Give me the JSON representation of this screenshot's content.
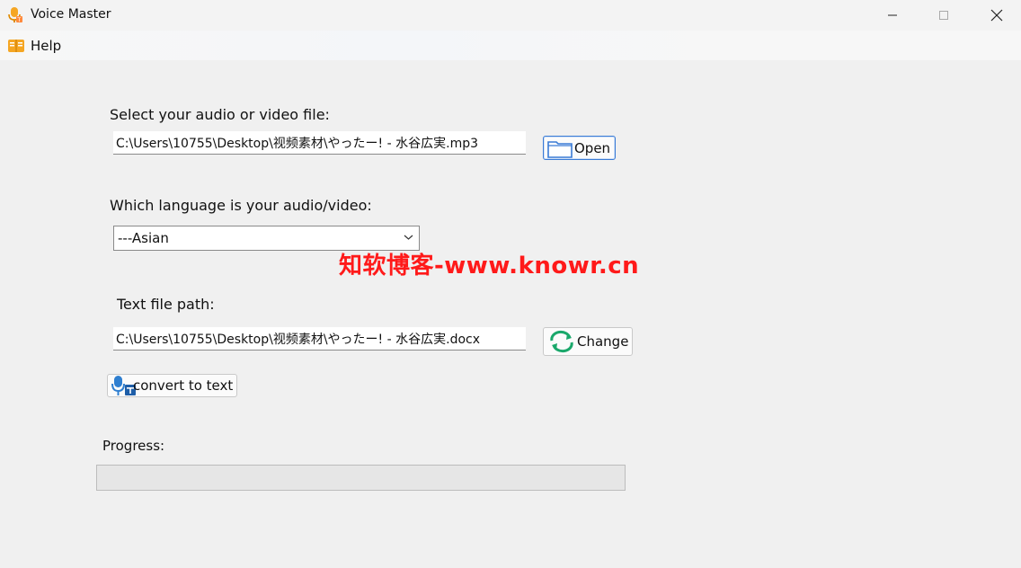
{
  "window": {
    "title": "Voice Master"
  },
  "menu": {
    "help_label": "Help"
  },
  "file_section": {
    "label": "Select your audio or video file:",
    "path_value": "C:\\Users\\10755\\Desktop\\视频素材\\やったー! - 水谷広実.mp3",
    "open_label": "Open"
  },
  "language_section": {
    "label": "Which language is your audio/video:",
    "selected": "---Asian"
  },
  "output_section": {
    "label": "Text file path:",
    "path_value": "C:\\Users\\10755\\Desktop\\视频素材\\やったー! - 水谷広実.docx",
    "change_label": "Change"
  },
  "convert": {
    "label": "convert to text"
  },
  "progress": {
    "label": "Progress:",
    "value": 0
  },
  "watermark": {
    "text": "知软博客-www.knowr.cn"
  },
  "icons": {
    "app": "microphone-icon",
    "help": "book-icon",
    "open": "folder-icon",
    "change": "refresh-icon",
    "convert": "microphone-convert-icon"
  },
  "colors": {
    "accent": "#3a7bd5",
    "change_icon": "#1aa86b",
    "watermark": "#ff1a1a"
  }
}
